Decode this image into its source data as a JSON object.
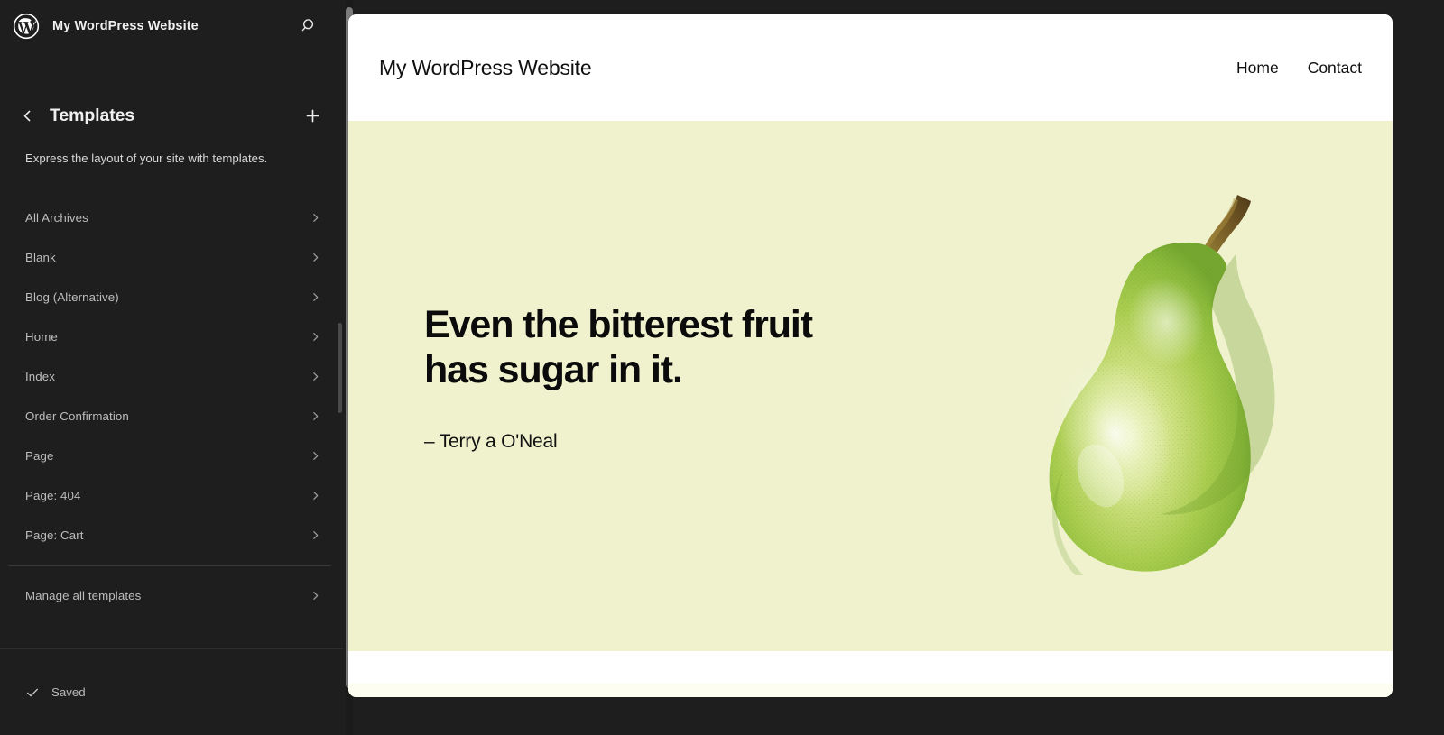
{
  "editor": {
    "brand_icon": "wordpress-logo-icon",
    "site_name": "My WordPress Website",
    "search_icon": "search-icon",
    "back_icon": "chevron-left-icon",
    "panel_title": "Templates",
    "add_icon": "plus-icon",
    "panel_description": "Express the layout of your site with templates.",
    "templates": [
      {
        "label": "All Archives"
      },
      {
        "label": "Blank"
      },
      {
        "label": "Blog (Alternative)"
      },
      {
        "label": "Home"
      },
      {
        "label": "Index"
      },
      {
        "label": "Order Confirmation"
      },
      {
        "label": "Page"
      },
      {
        "label": "Page: 404"
      },
      {
        "label": "Page: Cart"
      }
    ],
    "manage_all": {
      "label": "Manage all templates"
    },
    "footer": {
      "status_icon": "check-icon",
      "status_label": "Saved"
    },
    "colors": {
      "sidebar_bg": "#1e1e1e",
      "sidebar_text": "#bdbdbd",
      "canvas_bg": "#ffffff"
    }
  },
  "preview": {
    "header": {
      "site_title": "My WordPress Website",
      "nav": [
        {
          "label": "Home"
        },
        {
          "label": "Contact"
        }
      ]
    },
    "hero": {
      "background_color": "#eff2cd",
      "heading": "Even the bitterest fruit\nhas sugar in it.",
      "attribution": "– Terry a O'Neal",
      "image_name": "pear-illustration-image"
    }
  }
}
